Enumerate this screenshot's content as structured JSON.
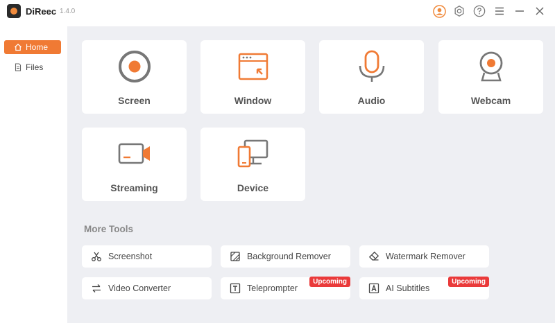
{
  "app": {
    "name": "DiReec",
    "version": "1.4.0"
  },
  "colors": {
    "accent": "#f07a34",
    "badge": "#ea3a3a"
  },
  "sidebar": {
    "items": [
      {
        "label": "Home",
        "icon": "home-icon",
        "active": true
      },
      {
        "label": "Files",
        "icon": "file-icon",
        "active": false
      }
    ]
  },
  "cards": [
    {
      "label": "Screen",
      "icon": "record-icon"
    },
    {
      "label": "Window",
      "icon": "window-icon"
    },
    {
      "label": "Audio",
      "icon": "microphone-icon"
    },
    {
      "label": "Webcam",
      "icon": "webcam-icon"
    },
    {
      "label": "Streaming",
      "icon": "video-camera-icon"
    },
    {
      "label": "Device",
      "icon": "device-icon"
    }
  ],
  "more_tools": {
    "title": "More Tools",
    "items": [
      {
        "label": "Screenshot",
        "icon": "scissors-icon"
      },
      {
        "label": "Background Remover",
        "icon": "background-remove-icon"
      },
      {
        "label": "Watermark Remover",
        "icon": "eraser-icon"
      },
      {
        "label": "Video Converter",
        "icon": "convert-arrows-icon"
      },
      {
        "label": "Teleprompter",
        "icon": "text-box-icon",
        "badge": "Upcoming"
      },
      {
        "label": "AI Subtitles",
        "icon": "subtitle-icon",
        "badge": "Upcoming"
      }
    ]
  }
}
